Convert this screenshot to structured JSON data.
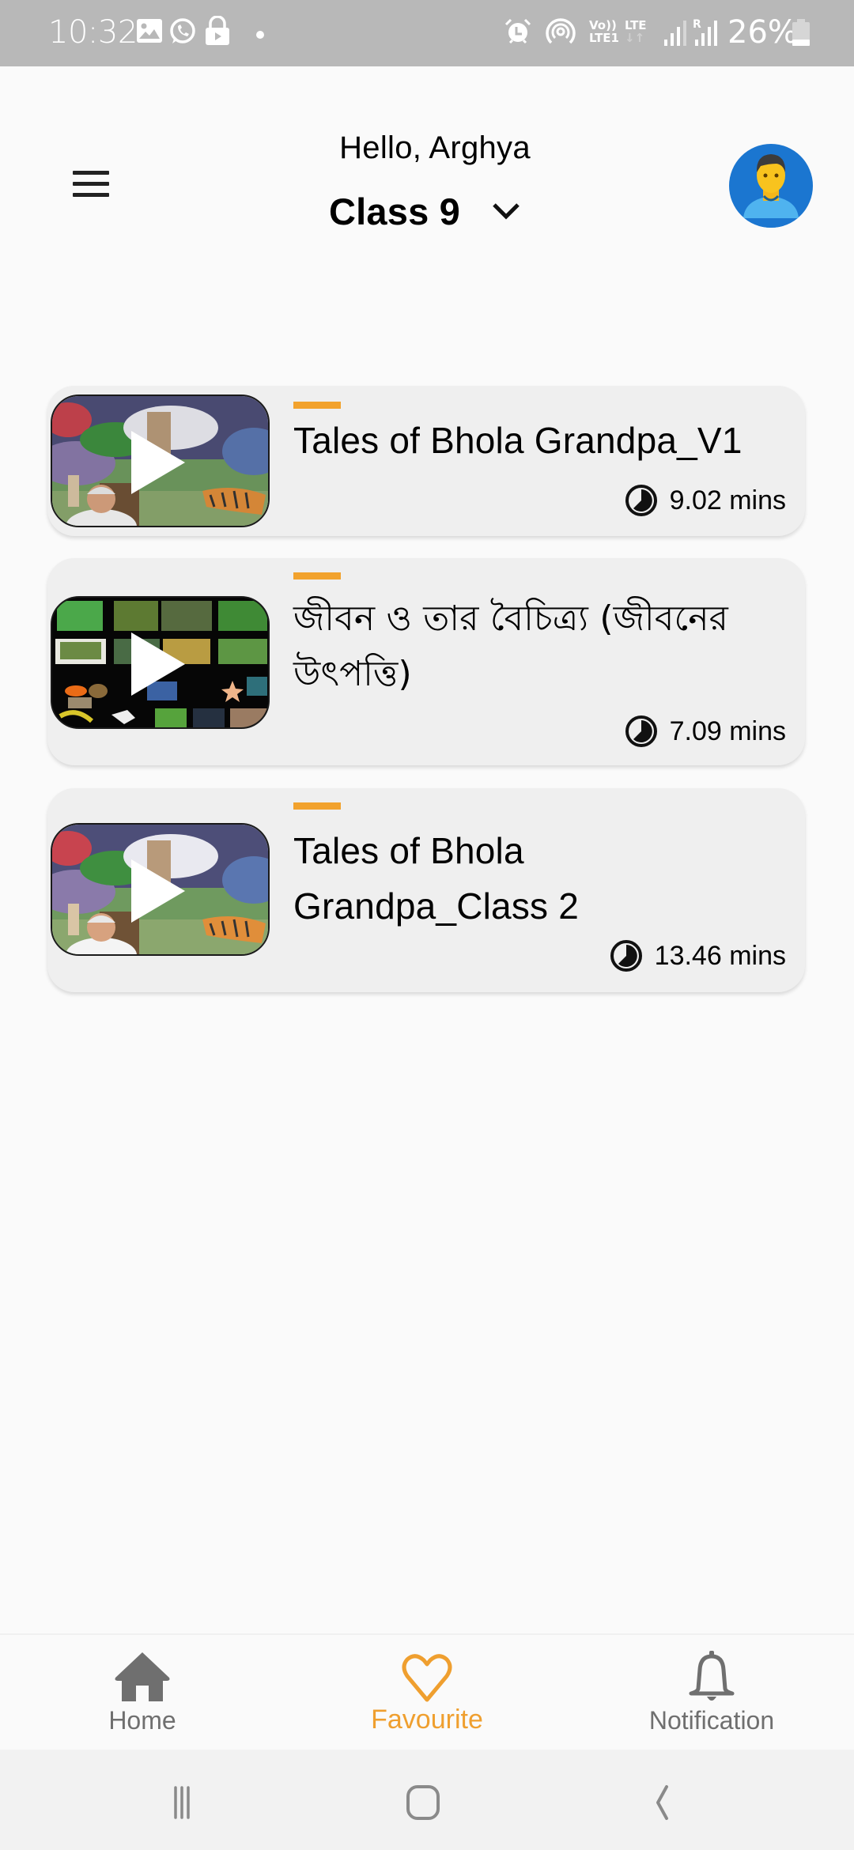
{
  "status_bar": {
    "time": "10:32",
    "left_icons": [
      "gallery-icon",
      "whatsapp-icon",
      "lock-play-icon",
      "dot-icon"
    ],
    "right_icons": [
      "alarm-icon",
      "hotspot-icon",
      "volte-icon",
      "lte-data-icon",
      "signal-icon",
      "roaming-signal-icon"
    ],
    "volte_top": "Vo))",
    "volte_bottom": "LTE1",
    "lte_label": "LTE",
    "roaming_label": "R",
    "battery_percent": "26%"
  },
  "header": {
    "greeting": "Hello, Arghya",
    "class_selected": "Class 9",
    "menu_icon": "hamburger-menu-icon",
    "avatar_icon": "user-avatar-icon"
  },
  "videos": [
    {
      "title": "Tales of Bhola Grandpa_V1",
      "duration": "9.02 mins",
      "thumbnail": "cartoon-story-thumbnail"
    },
    {
      "title": "জীবন ও তার বৈচিত্র্য (জীবনের উৎপত্তি)",
      "duration": "7.09 mins",
      "thumbnail": "biodiversity-collage-thumbnail"
    },
    {
      "title": "Tales of Bhola Grandpa_Class 2",
      "duration": "13.46 mins",
      "thumbnail": "cartoon-story-thumbnail"
    }
  ],
  "bottom_nav": {
    "items": [
      {
        "label": "Home",
        "icon": "home-icon",
        "active": false
      },
      {
        "label": "Favourite",
        "icon": "heart-icon",
        "active": true
      },
      {
        "label": "Notification",
        "icon": "bell-icon",
        "active": false
      }
    ]
  },
  "system_nav": [
    "recent-apps-icon",
    "home-button-icon",
    "back-icon"
  ],
  "colors": {
    "accent": "#f2a22d",
    "active_nav": "#ef9f2f",
    "inactive_nav": "#6f6f6f",
    "card_bg": "#efefef",
    "avatar_bg": "#1b76d0",
    "status_bar_bg": "#b8b8b8"
  }
}
